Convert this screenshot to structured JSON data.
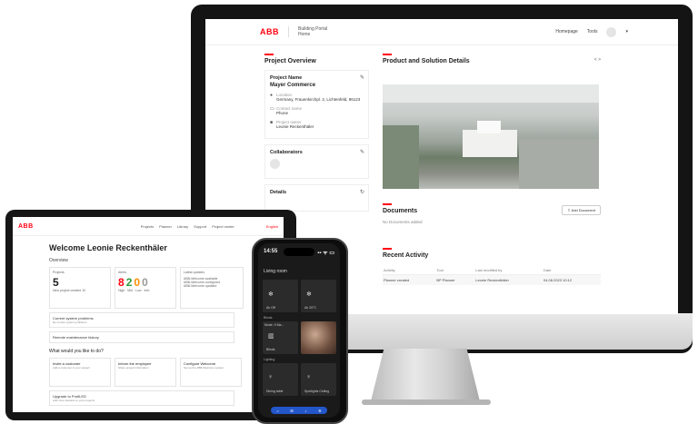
{
  "desktop": {
    "header": {
      "logo": "ABB",
      "brand_line1": "Building Portal",
      "brand_line2": "Home",
      "nav_homepage": "Homepage",
      "nav_tools": "Tools"
    },
    "project_overview": {
      "title": "Project Overview",
      "project_name_label": "Project Name",
      "project_name": "Mayer Commerce",
      "location_label": "Location",
      "location_value": "Germany, Frauenkirchpl. 2, Lichtenfeld, 96123",
      "contact_label": "Contact name",
      "contact_value": "Phone",
      "owner_label": "Project owner",
      "owner_value": "Leonie Reckenthäler",
      "collaborators_title": "Collaborators",
      "details_title": "Details"
    },
    "product_details": {
      "title": "Product and Solution Details",
      "page_indicator": "< >"
    },
    "documents": {
      "title": "Documents",
      "add_button": "Add Document",
      "empty_text": "No Documents added"
    },
    "recent_activity": {
      "title": "Recent Activity",
      "columns": [
        "Activity",
        "Tool",
        "Last modified by",
        "Date"
      ],
      "rows": [
        [
          "Planner created",
          "BP Planner",
          "Leonie Reckenthäler",
          "04.08.2023 10:12"
        ]
      ]
    }
  },
  "tablet": {
    "header": {
      "logo": "ABB",
      "nav": [
        "Projects",
        "Planner",
        "Library",
        "Support",
        "Project center"
      ],
      "language": "English"
    },
    "welcome": "Welcome Leonie Reckenthäler",
    "overview_label": "Overview",
    "projects_card": {
      "label": "Projects",
      "value": "5",
      "footer": "New project created 10"
    },
    "alerts_card": {
      "label": "Alerts",
      "values": [
        "8",
        "2",
        "0",
        "0"
      ],
      "footer": "High · Mid · Low · Info"
    },
    "updates_card": {
      "label": "Latest updates",
      "items": [
        "ABB-Welcome available",
        "ABB-Welcome configured",
        "ABB-Welcome updated"
      ]
    },
    "current_problems": {
      "title": "Current system problems",
      "subtitle": "No current system problems"
    },
    "maintenance": {
      "title": "Remote maintenance history"
    },
    "question": "What would you like to do?",
    "actions": [
      {
        "title": "Invite a customer",
        "desc": "Add a customer to your project"
      },
      {
        "title": "Inform the employee",
        "desc": "Share project information"
      },
      {
        "title": "Configure Welcome",
        "desc": "Set up the ABB-Welcome system"
      }
    ],
    "upgrade": {
      "title": "Upgrade to ProfiLED",
      "desc": "Add more features to your projects"
    }
  },
  "phone": {
    "time": "14:55",
    "signal": "▪▪ ᯤ ▭",
    "room_title": "Living room",
    "tiles": [
      {
        "label": "Air Off",
        "icon": "ac-icon"
      },
      {
        "label": "Air 20°C",
        "icon": "ac-icon"
      },
      {
        "label": "Blinds",
        "icon": "blind-icon"
      },
      {
        "label": "Photo",
        "icon": "photo"
      },
      {
        "label": "Dining table",
        "icon": "lamp-icon"
      },
      {
        "label": "Spotlights Ceiling",
        "icon": "lamp-icon"
      }
    ],
    "sections": [
      "Blinds",
      "Lighting"
    ],
    "blinds_mode": "Mode: 0 Ma...",
    "bottom_bar": [
      "⌂",
      "⊞",
      "♪",
      "⚙"
    ]
  }
}
